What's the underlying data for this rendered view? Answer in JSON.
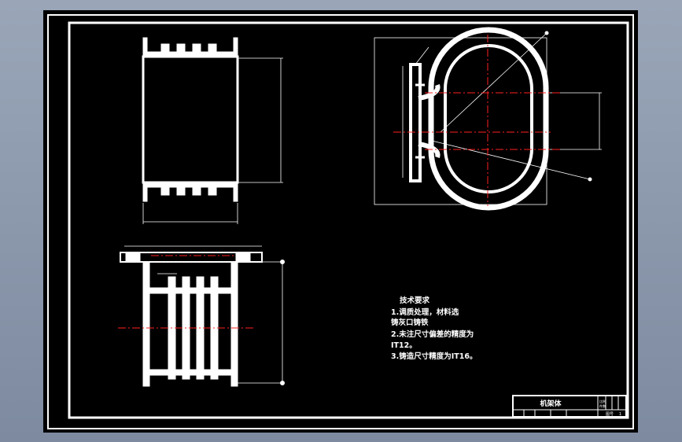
{
  "colors": {
    "background": "#8e9aae",
    "paper": "#000000",
    "line": "#ffffff",
    "centerline": "#ff2020"
  },
  "technical_requirements": {
    "heading": "技术要求",
    "lines": [
      "1.调质处理，材料选",
      "铸灰口铸铁",
      "2.未注尺寸偏差的精度为",
      "IT12。",
      "3.铸造尺寸精度为IT16。"
    ]
  },
  "title_block": {
    "part_name": "机架体",
    "scale_label": "比例",
    "quantity_label": "件数",
    "sheet_label": "图号",
    "sheet_value": "1"
  }
}
